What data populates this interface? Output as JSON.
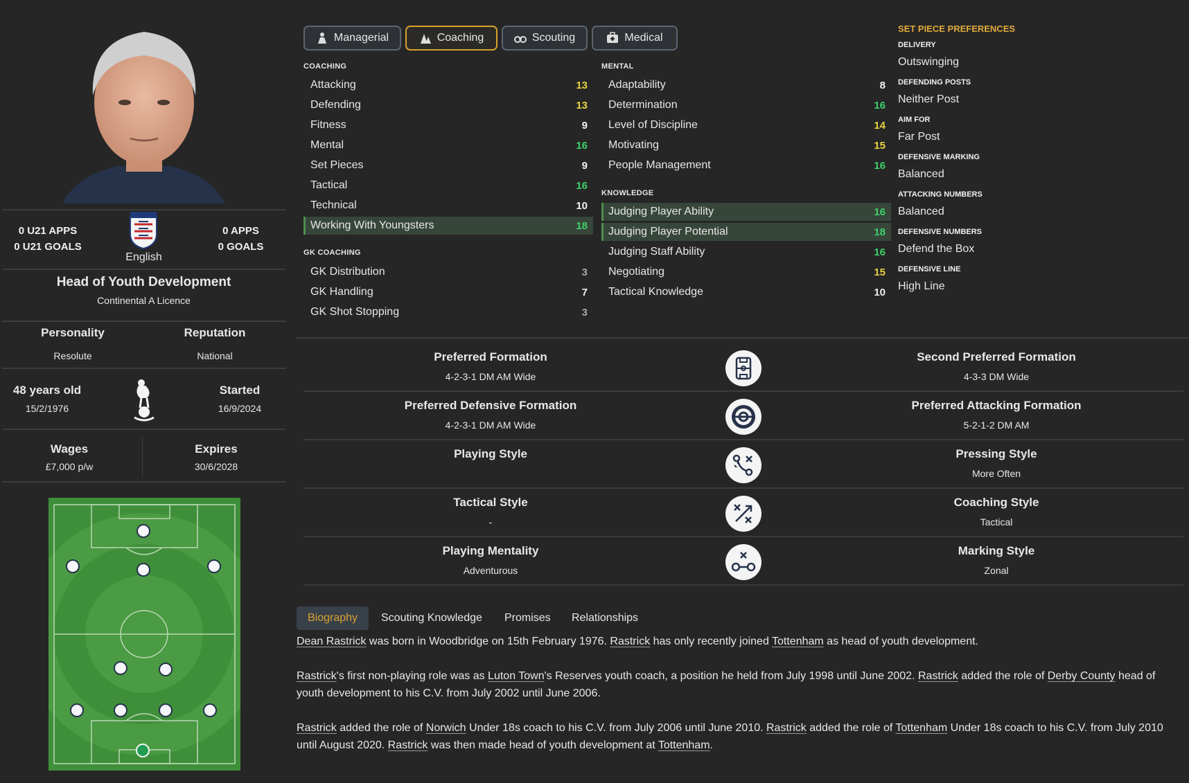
{
  "profile": {
    "u21_apps": "0 U21 APPS",
    "u21_goals": "0 U21 GOALS",
    "apps": "0 APPS",
    "goals": "0 GOALS",
    "nationality": "English",
    "fa_badge_text": "TheFA",
    "role": "Head of Youth Development",
    "licence": "Continental A Licence",
    "personality_label": "Personality",
    "personality": "Resolute",
    "reputation_label": "Reputation",
    "reputation": "National",
    "age": "48 years old",
    "dob": "15/2/1976",
    "started_label": "Started",
    "started": "16/9/2024",
    "wages_label": "Wages",
    "wages": "£7,000 p/w",
    "expires_label": "Expires",
    "expires": "30/6/2028"
  },
  "tabs": [
    {
      "label": "Managerial",
      "icon": "managerial-icon"
    },
    {
      "label": "Coaching",
      "icon": "coaching-icon",
      "active": true
    },
    {
      "label": "Scouting",
      "icon": "binoculars-icon"
    },
    {
      "label": "Medical",
      "icon": "medical-kit-icon"
    }
  ],
  "coaching": {
    "title": "COACHING",
    "items": [
      {
        "name": "Attacking",
        "value": "13",
        "color": "yellow"
      },
      {
        "name": "Defending",
        "value": "13",
        "color": "yellow"
      },
      {
        "name": "Fitness",
        "value": "9",
        "color": "white"
      },
      {
        "name": "Mental",
        "value": "16",
        "color": "green"
      },
      {
        "name": "Set Pieces",
        "value": "9",
        "color": "white"
      },
      {
        "name": "Tactical",
        "value": "16",
        "color": "green"
      },
      {
        "name": "Technical",
        "value": "10",
        "color": "white"
      },
      {
        "name": "Working With Youngsters",
        "value": "18",
        "color": "green",
        "highlight": true
      }
    ]
  },
  "gk_coaching": {
    "title": "GK COACHING",
    "items": [
      {
        "name": "GK Distribution",
        "value": "3",
        "color": "grey"
      },
      {
        "name": "GK Handling",
        "value": "7",
        "color": "white"
      },
      {
        "name": "GK Shot Stopping",
        "value": "3",
        "color": "grey"
      }
    ]
  },
  "mental": {
    "title": "MENTAL",
    "items": [
      {
        "name": "Adaptability",
        "value": "8",
        "color": "white"
      },
      {
        "name": "Determination",
        "value": "16",
        "color": "green"
      },
      {
        "name": "Level of Discipline",
        "value": "14",
        "color": "yellow"
      },
      {
        "name": "Motivating",
        "value": "15",
        "color": "yellow"
      },
      {
        "name": "People Management",
        "value": "16",
        "color": "green"
      }
    ]
  },
  "knowledge": {
    "title": "KNOWLEDGE",
    "items": [
      {
        "name": "Judging Player Ability",
        "value": "16",
        "color": "green",
        "highlight": true
      },
      {
        "name": "Judging Player Potential",
        "value": "18",
        "color": "green",
        "highlight": true
      },
      {
        "name": "Judging Staff Ability",
        "value": "16",
        "color": "green"
      },
      {
        "name": "Negotiating",
        "value": "15",
        "color": "yellow"
      },
      {
        "name": "Tactical Knowledge",
        "value": "10",
        "color": "white"
      }
    ]
  },
  "set_pieces": {
    "title": "SET PIECE PREFERENCES",
    "items": [
      {
        "label": "DELIVERY",
        "value": "Outswinging"
      },
      {
        "label": "DEFENDING POSTS",
        "value": "Neither Post"
      },
      {
        "label": "AIM FOR",
        "value": "Far Post"
      },
      {
        "label": "DEFENSIVE MARKING",
        "value": "Balanced"
      },
      {
        "label": "ATTACKING NUMBERS",
        "value": "Balanced"
      },
      {
        "label": "DEFENSIVE NUMBERS",
        "value": "Defend the Box"
      },
      {
        "label": "DEFENSIVE LINE",
        "value": "High Line"
      }
    ]
  },
  "formations": [
    {
      "left_title": "Preferred Formation",
      "left_value": "4-2-3-1 DM AM Wide",
      "icon": "formation-board-icon",
      "right_title": "Second Preferred Formation",
      "right_value": "4-3-3 DM Wide"
    },
    {
      "left_title": "Preferred Defensive Formation",
      "left_value": "4-2-3-1 DM AM Wide",
      "icon": "defensive-target-icon",
      "right_title": "Preferred Attacking Formation",
      "right_value": "5-2-1-2 DM AM"
    },
    {
      "left_title": "Playing Style",
      "left_value": "",
      "icon": "tactics-arrows-icon",
      "right_title": "Pressing Style",
      "right_value": "More Often"
    },
    {
      "left_title": "Tactical Style",
      "left_value": "-",
      "icon": "tactics-cross-icon",
      "right_title": "Coaching Style",
      "right_value": "Tactical"
    },
    {
      "left_title": "Playing Mentality",
      "left_value": "Adventurous",
      "icon": "marking-link-icon",
      "right_title": "Marking Style",
      "right_value": "Zonal"
    }
  ],
  "bio_tabs": [
    "Biography",
    "Scouting Knowledge",
    "Promises",
    "Relationships"
  ],
  "bio": {
    "p1": {
      "name": "Dean Rastrick",
      "t1": " was born in Woodbridge on 15th February 1976. ",
      "n2": "Rastrick",
      "t2": " has only recently joined ",
      "club": "Tottenham",
      "t3": " as head of youth development."
    },
    "p2": {
      "n1": "Rastrick",
      "t1": "'s first non-playing role was as ",
      "c1": "Luton Town",
      "t2": "'s Reserves youth coach, a position he held from July 1998 until June 2002. ",
      "n2": "Rastrick",
      "t3": " added the role of ",
      "c2": "Derby County",
      "t4": " head of youth development to his C.V. from July 2002 until June 2006."
    },
    "p3": {
      "n1": "Rastrick",
      "t1": " added the role of ",
      "c1": "Norwich",
      "t2": " Under 18s coach to his C.V. from July 2006 until June 2010. ",
      "n2": "Rastrick",
      "t3": " added the role of ",
      "c2": "Tottenham",
      "t4": " Under 18s coach to his C.V. from July 2010 until August 2020. ",
      "n3": "Rastrick",
      "t5": " was then made head of youth development at ",
      "c3": "Tottenham",
      "t6": "."
    }
  },
  "colors": {
    "yellow": "#e7d343",
    "green": "#3fd06b",
    "accent": "#d9a22e"
  }
}
